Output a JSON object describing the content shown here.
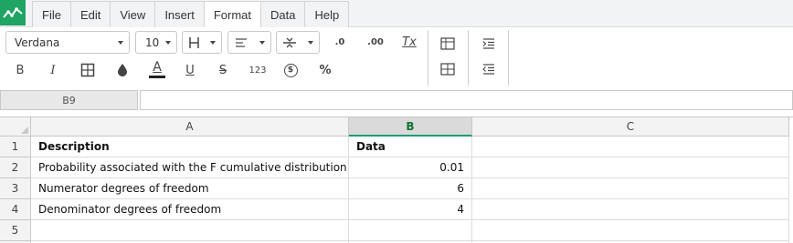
{
  "app": {
    "menus": [
      "File",
      "Edit",
      "View",
      "Insert",
      "Format",
      "Data",
      "Help"
    ],
    "active_menu": "Format"
  },
  "toolbar": {
    "font_family": "Verdana",
    "font_size": "10",
    "bold_label": "B",
    "italic_label": "I",
    "text_color_label": "A",
    "underline_label": "U",
    "strike_label": "S",
    "number_format_label": "123",
    "currency_label": "$",
    "percent_label": "%",
    "decrease_decimals_label": ".0",
    "increase_decimals_label": ".00",
    "clear_format_label": "Tx"
  },
  "formula_bar": {
    "cell_ref": "B9",
    "value": ""
  },
  "sheet": {
    "columns": [
      "A",
      "B",
      "C"
    ],
    "selected_column": "B",
    "rows": [
      {
        "num": "1",
        "a": "Description",
        "b": "Data",
        "c": ""
      },
      {
        "num": "2",
        "a": "Probability associated with the F cumulative distribution",
        "b": "0.01",
        "c": ""
      },
      {
        "num": "3",
        "a": "Numerator degrees of freedom",
        "b": "6",
        "c": ""
      },
      {
        "num": "4",
        "a": "Denominator degrees of freedom",
        "b": "4",
        "c": ""
      },
      {
        "num": "5",
        "a": "",
        "b": "",
        "c": ""
      }
    ]
  }
}
